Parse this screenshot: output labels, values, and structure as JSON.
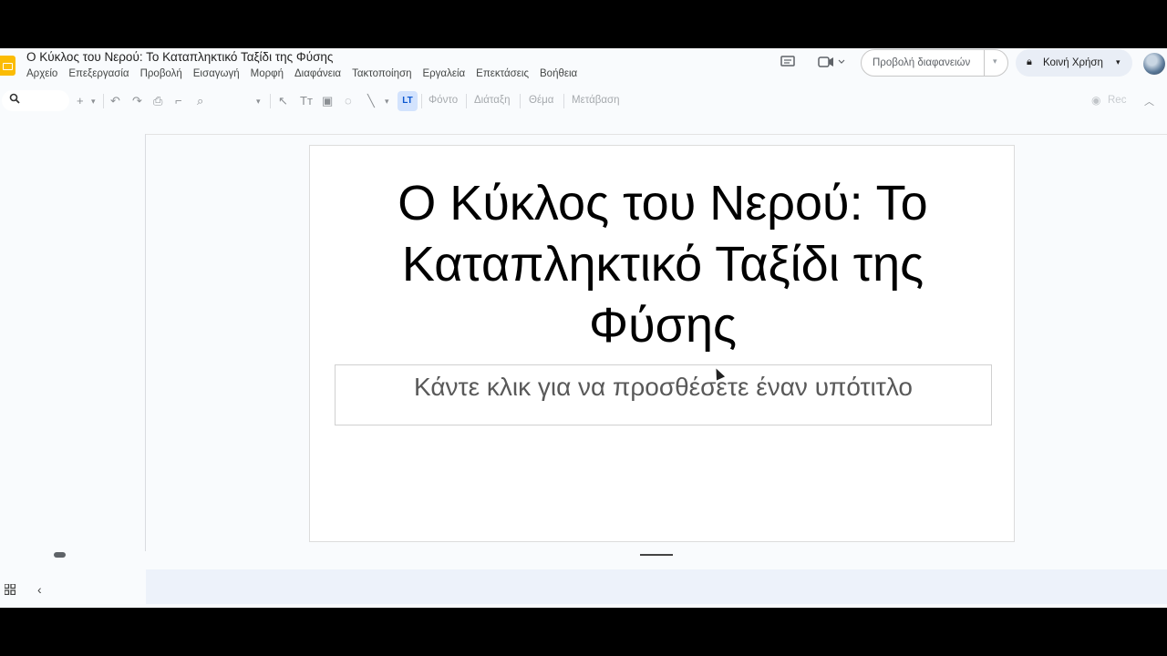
{
  "header": {
    "doc_title": "Ο Κύκλος του Νερού: Το Καταπληκτικό Ταξίδι της Φύσης",
    "menu": [
      "Αρχείο",
      "Επεξεργασία",
      "Προβολή",
      "Εισαγωγή",
      "Μορφή",
      "Διαφάνεια",
      "Τακτοποίηση",
      "Εργαλεία",
      "Επεκτάσεις",
      "Βοήθεια"
    ],
    "slideshow_label": "Προβολή διαφανειών",
    "share_label": "Κοινή Χρήση"
  },
  "toolbar": {
    "background_label": "Φόντο",
    "layout_label": "Διάταξη",
    "theme_label": "Θέμα",
    "transition_label": "Μετάβαση",
    "rec_label": "Rec"
  },
  "slide": {
    "title": "Ο Κύκλος του Νερού: Το Καταπληκτικό Ταξίδι της Φύσης",
    "subtitle_placeholder": "Κάντε κλικ για να προσθέσετε έναν υπότιτλο"
  },
  "colors": {
    "accent": "#0b57d0",
    "logo": "#fbbc04",
    "share_bg": "#e9eef6"
  },
  "icons": [
    "slides-logo-icon",
    "comments-icon",
    "meet-icon",
    "lock-icon",
    "search-icon",
    "add-icon",
    "undo-icon",
    "redo-icon",
    "print-icon",
    "paint-format-icon",
    "zoom-icon",
    "select-icon",
    "textbox-icon",
    "image-icon",
    "shape-icon",
    "line-icon",
    "rec-icon",
    "collapse-icon",
    "grid-view-icon",
    "chevron-left-icon"
  ]
}
